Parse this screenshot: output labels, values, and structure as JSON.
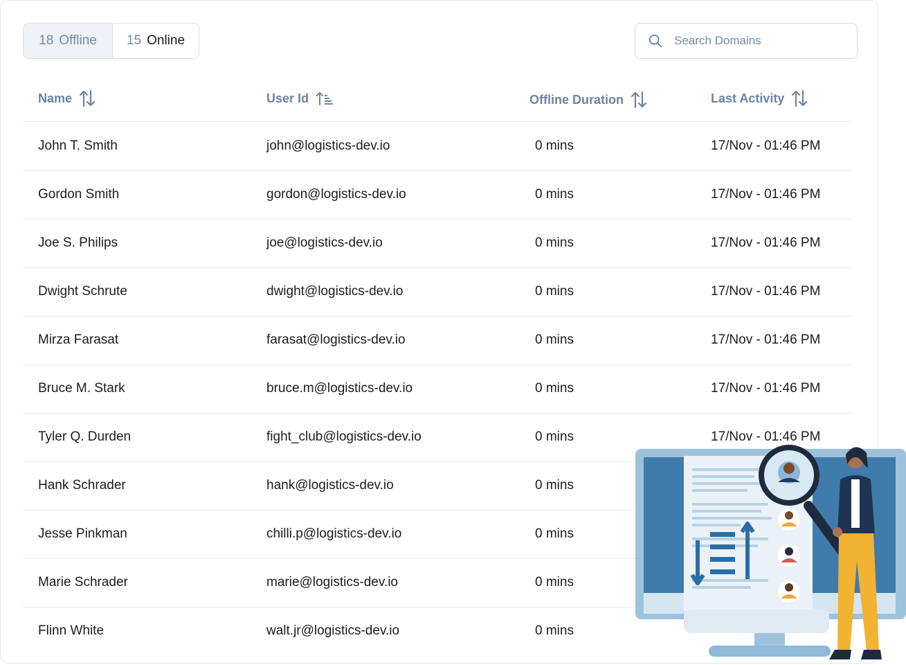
{
  "tabs": {
    "offline": {
      "count": "18",
      "label": "Offline"
    },
    "online": {
      "count": "15",
      "label": "Online"
    }
  },
  "search": {
    "placeholder": "Search Domains"
  },
  "table": {
    "columns": {
      "name": "Name",
      "user_id": "User Id",
      "offline_duration": "Offline Duration",
      "last_activity": "Last Activity"
    },
    "rows": [
      {
        "name": "John T. Smith",
        "user_id": "john@logistics-dev.io",
        "duration": "0 mins",
        "last": "17/Nov - 01:46 PM"
      },
      {
        "name": "Gordon Smith",
        "user_id": "gordon@logistics-dev.io",
        "duration": "0 mins",
        "last": "17/Nov - 01:46 PM"
      },
      {
        "name": "Joe S. Philips",
        "user_id": "joe@logistics-dev.io",
        "duration": "0 mins",
        "last": "17/Nov - 01:46 PM"
      },
      {
        "name": "Dwight Schrute",
        "user_id": "dwight@logistics-dev.io",
        "duration": "0 mins",
        "last": "17/Nov - 01:46 PM"
      },
      {
        "name": "Mirza Farasat",
        "user_id": "farasat@logistics-dev.io",
        "duration": "0 mins",
        "last": "17/Nov - 01:46 PM"
      },
      {
        "name": "Bruce M. Stark",
        "user_id": "bruce.m@logistics-dev.io",
        "duration": "0 mins",
        "last": "17/Nov - 01:46 PM"
      },
      {
        "name": "Tyler Q. Durden",
        "user_id": "fight_club@logistics-dev.io",
        "duration": "0 mins",
        "last": "17/Nov - 01:46 PM"
      },
      {
        "name": "Hank Schrader",
        "user_id": "hank@logistics-dev.io",
        "duration": "0 mins",
        "last": ""
      },
      {
        "name": "Jesse Pinkman",
        "user_id": "chilli.p@logistics-dev.io",
        "duration": "0 mins",
        "last": ""
      },
      {
        "name": "Marie Schrader",
        "user_id": "marie@logistics-dev.io",
        "duration": "0 mins",
        "last": ""
      },
      {
        "name": "Flinn White",
        "user_id": "walt.jr@logistics-dev.io",
        "duration": "0 mins",
        "last": ""
      }
    ]
  },
  "icons": {
    "search": "search-icon",
    "sort": "sort-arrows-icon",
    "sort_active": "sort-ascending-lines-icon"
  },
  "colors": {
    "header_text": "#6b84a6",
    "muted_text": "#7689a3",
    "border": "#e7eaee",
    "tab_bg": "#eef1f5"
  }
}
